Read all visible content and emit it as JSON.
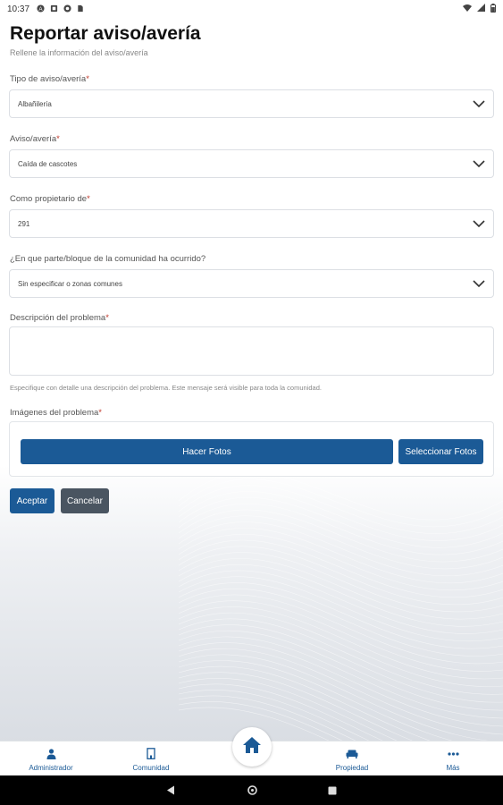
{
  "status_bar": {
    "time": "10:37",
    "left_icons": [
      "a-icon",
      "square-icon",
      "circle-icon",
      "sim-icon"
    ],
    "right_icons": [
      "wifi-icon",
      "signal-icon",
      "battery-icon"
    ]
  },
  "header": {
    "title": "Reportar aviso/avería",
    "subtitle": "Rellene la información del aviso/avería"
  },
  "form": {
    "tipo": {
      "label": "Tipo de aviso/avería",
      "required": "*",
      "value": "Albañilería"
    },
    "aviso": {
      "label": "Aviso/avería",
      "required": "*",
      "value": "Caída de cascotes"
    },
    "propietario": {
      "label": "Como propietario de",
      "required": "*",
      "value": "291"
    },
    "bloque": {
      "label": "¿En que parte/bloque de la comunidad ha ocurrido?",
      "value": "Sin especificar o zonas comunes"
    },
    "descripcion": {
      "label": "Descripción del problema",
      "required": "*",
      "value": "",
      "help": "Especifique con detalle una descripción del problema. Este mensaje será visible para toda la comunidad."
    },
    "imagenes": {
      "label": "Imágenes del problema",
      "required": "*"
    },
    "buttons": {
      "take_photos": "Hacer Fotos",
      "select_photos": "Seleccionar Fotos",
      "accept": "Aceptar",
      "cancel": "Cancelar"
    }
  },
  "bottom_nav": {
    "items": [
      {
        "label": "Administrador",
        "icon": "person-icon"
      },
      {
        "label": "Comunidad",
        "icon": "building-icon"
      },
      {
        "label": "",
        "icon": "home-icon"
      },
      {
        "label": "Propiedad",
        "icon": "sofa-icon"
      },
      {
        "label": "Más",
        "icon": "more-icon"
      }
    ]
  },
  "colors": {
    "primary": "#1b5a96",
    "secondary_button": "#4a5561",
    "required": "#c0392b"
  }
}
